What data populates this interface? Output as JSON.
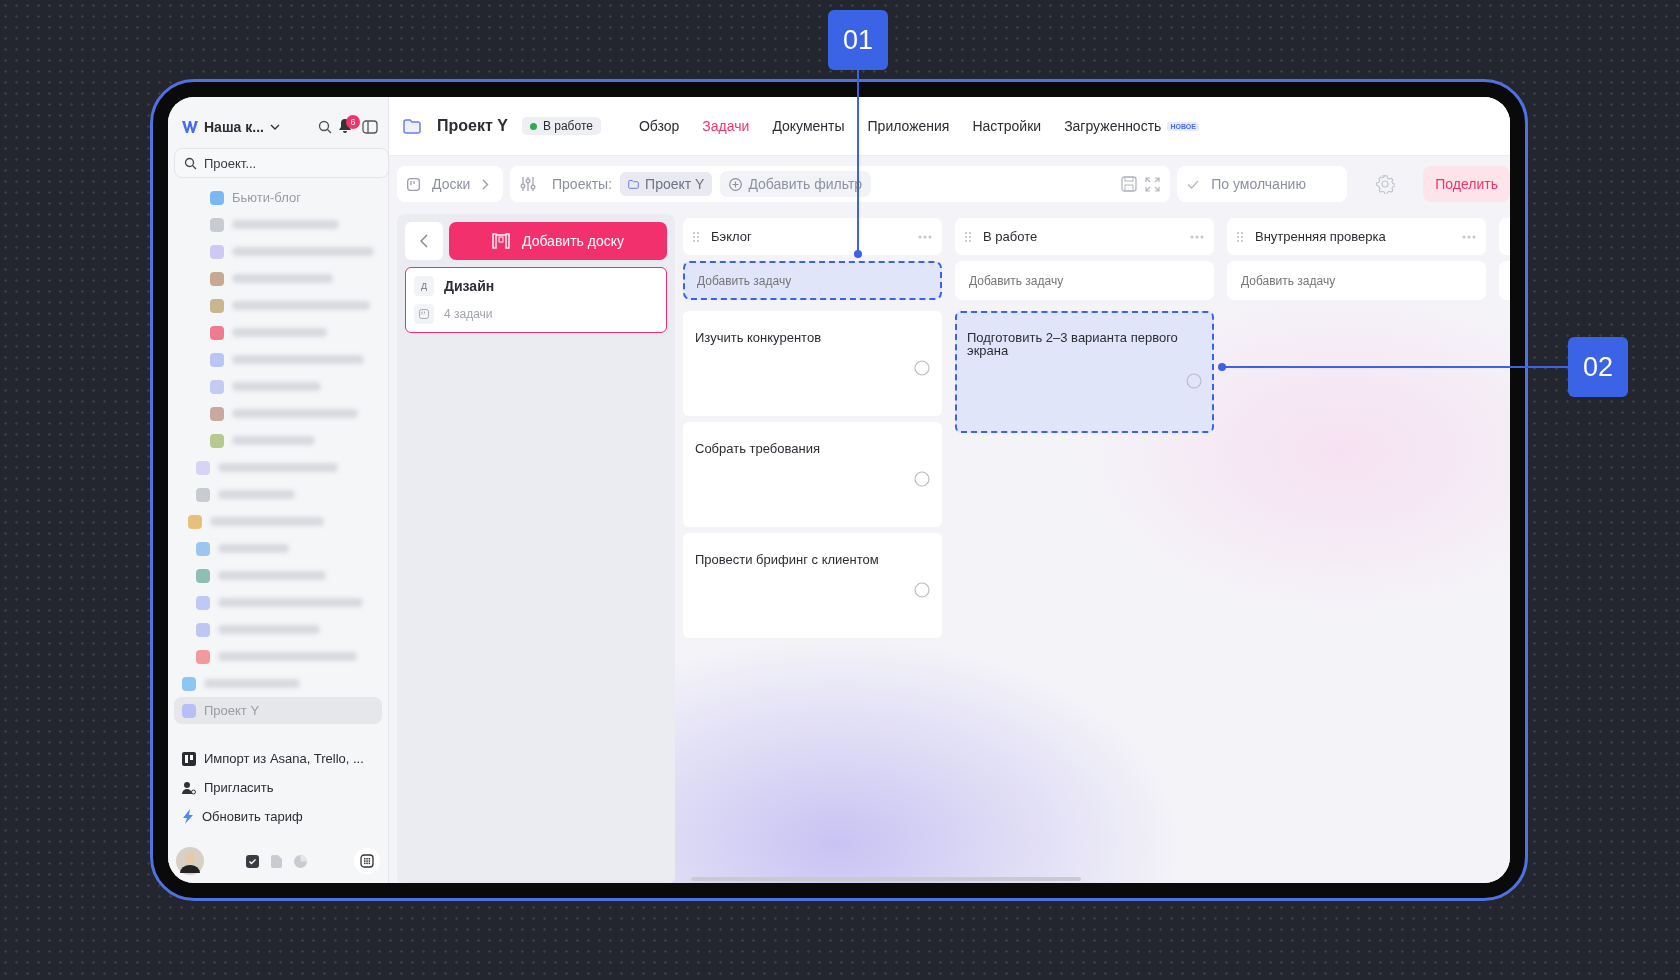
{
  "sidebar": {
    "workspace": "Наша к...",
    "notification_count": "6",
    "search": {
      "placeholder": "Проект..."
    },
    "items": [
      {
        "kind": "project",
        "label": "Бьюти-блог",
        "color": "#7ab8f5",
        "selected": false
      },
      {
        "kind": "blurred",
        "color": "#c9cbd2",
        "selected": false
      },
      {
        "kind": "blurred",
        "color": "#cfc8f5",
        "selected": false
      },
      {
        "kind": "blurred",
        "color": "#c8a891",
        "selected": false
      },
      {
        "kind": "blurred",
        "color": "#c9b58e",
        "selected": false
      },
      {
        "kind": "blurred",
        "color": "#f07a8e",
        "selected": false
      },
      {
        "kind": "blurred",
        "color": "#b9c6f5",
        "selected": false
      },
      {
        "kind": "blurred",
        "color": "#c3cbf2",
        "selected": false
      },
      {
        "kind": "blurred",
        "color": "#c9a8a0",
        "selected": false
      },
      {
        "kind": "blurred",
        "color": "#b8c98f",
        "selected": false
      },
      {
        "kind": "blurred",
        "color": "#d6d3f5",
        "selected": false
      },
      {
        "kind": "blurred",
        "color": "#c9cbd2",
        "selected": false
      },
      {
        "kind": "blurred",
        "color": "#e8c07e",
        "selected": false
      },
      {
        "kind": "blurred",
        "color": "#9cc6ef",
        "selected": false
      },
      {
        "kind": "blurred",
        "color": "#8fbfb4",
        "selected": false
      },
      {
        "kind": "blurred",
        "color": "#bfc9f3",
        "selected": false
      },
      {
        "kind": "blurred",
        "color": "#bcc7f3",
        "selected": false
      },
      {
        "kind": "blurred",
        "color": "#f19a9e",
        "selected": false
      },
      {
        "kind": "blurred",
        "color": "#8ec6f3",
        "selected": false
      },
      {
        "kind": "project",
        "label": "Проект Y",
        "color": "#b7bff5",
        "selected": true
      }
    ],
    "links": [
      {
        "kind": "import",
        "label": "Импорт из Asana, Trello, ..."
      },
      {
        "kind": "invite",
        "label": "Пригласить"
      },
      {
        "kind": "upgrade",
        "label": "Обновить тариф"
      }
    ]
  },
  "header": {
    "title": "Проект Y",
    "status": {
      "label": "В работе",
      "color": "#34a853"
    },
    "tabs": [
      {
        "label": "Обзор",
        "selected": false
      },
      {
        "label": "Задачи",
        "selected": true
      },
      {
        "label": "Документы",
        "selected": false
      },
      {
        "label": "Приложения",
        "selected": false
      },
      {
        "label": "Настройки",
        "selected": false
      },
      {
        "label": "Загруженность",
        "selected": false,
        "badge": "НОВОЕ"
      }
    ]
  },
  "toolbar": {
    "view": "Доски",
    "filter_label": "Проекты:",
    "filter_value": "Проект Y",
    "add_filter": "Добавить фильтр",
    "preset": "По умолчанию",
    "share": "Поделить"
  },
  "boards": {
    "add_button": "Добавить доску",
    "items": [
      {
        "letter": "Д",
        "name": "Дизайн",
        "count": "4 задачи",
        "selected": true
      }
    ]
  },
  "columns": [
    {
      "title": "Бэклог",
      "add_placeholder": "Добавить задачу",
      "add_highlighted": true,
      "tasks": [
        {
          "title": "Изучить конкурентов",
          "highlighted": false
        },
        {
          "title": "Собрать требования",
          "highlighted": false
        },
        {
          "title": "Провести брифинг с клиентом",
          "highlighted": false
        }
      ]
    },
    {
      "title": "В работе",
      "add_placeholder": "Добавить задачу",
      "add_highlighted": false,
      "tasks": [
        {
          "title": "Подготовить 2–3 варианта первого экрана",
          "highlighted": true
        }
      ]
    },
    {
      "title": "Внутренняя проверка",
      "add_placeholder": "Добавить задачу",
      "add_highlighted": false
    }
  ],
  "callouts": [
    {
      "label": "01"
    },
    {
      "label": "02"
    }
  ]
}
